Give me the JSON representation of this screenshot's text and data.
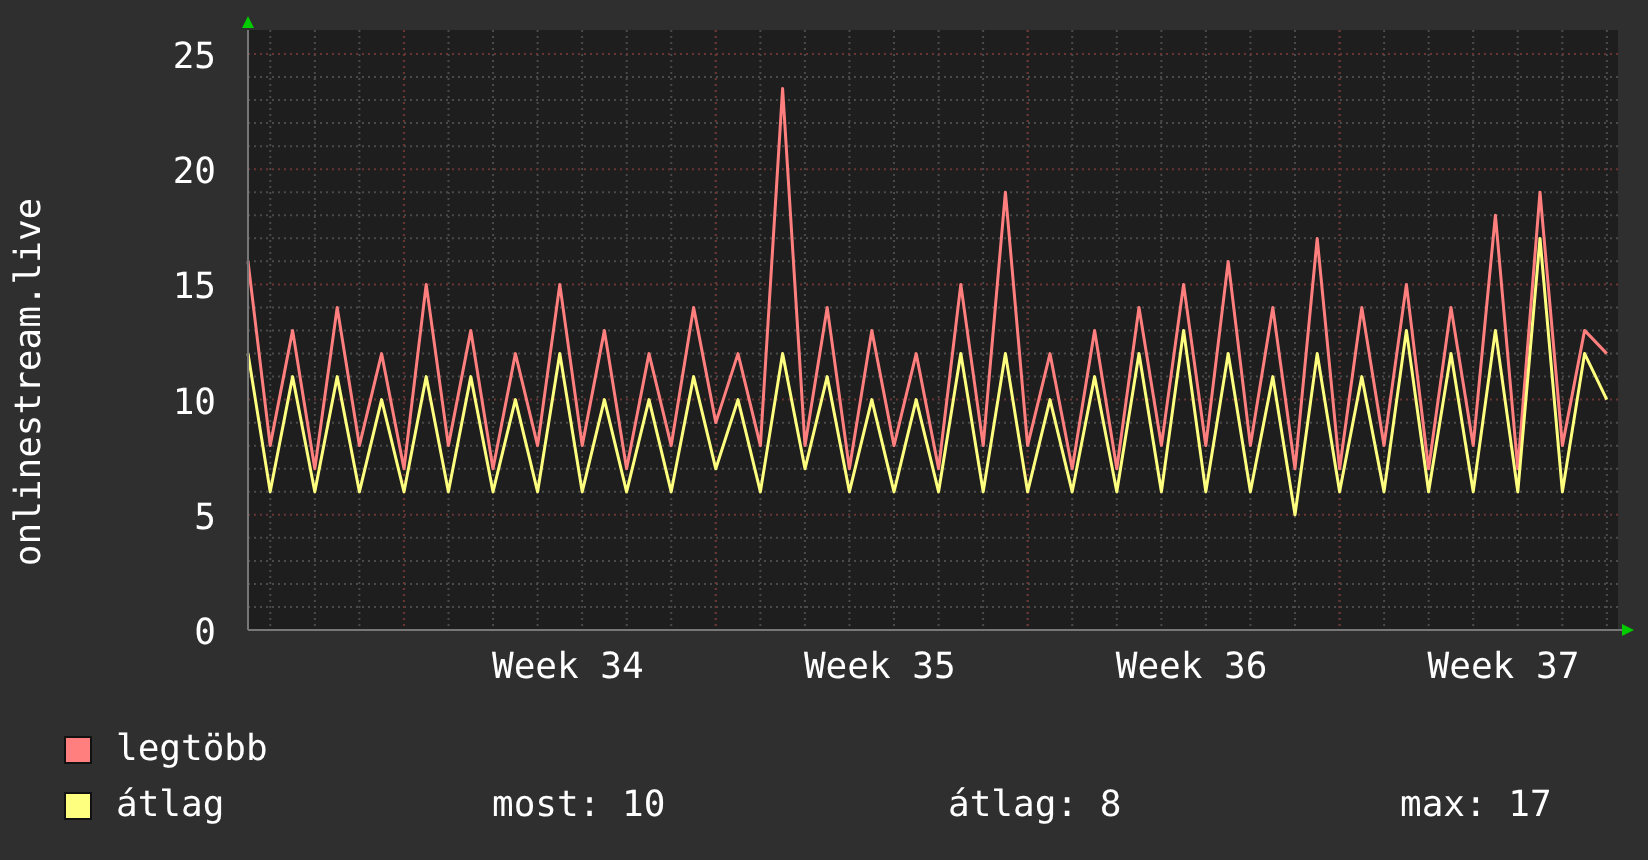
{
  "chart": {
    "chart_data": {
      "type": "line",
      "ylabel": "onlinestream.live",
      "categories": [
        null,
        null,
        null,
        null,
        null,
        null,
        null,
        null,
        null,
        null,
        null,
        null,
        null,
        null,
        "Week 34",
        null,
        null,
        null,
        null,
        null,
        null,
        null,
        null,
        null,
        null,
        null,
        null,
        null,
        "Week 35",
        null,
        null,
        null,
        null,
        null,
        null,
        null,
        null,
        null,
        null,
        null,
        null,
        null,
        "Week 36",
        null,
        null,
        null,
        null,
        null,
        null,
        null,
        null,
        null,
        null,
        null,
        null,
        null,
        "Week 37",
        null,
        null,
        null,
        null,
        null
      ],
      "series": [
        {
          "name": "legtöbb",
          "color": "#ff7f7f",
          "values": [
            16,
            8,
            13,
            7,
            14,
            8,
            12,
            7,
            15,
            8,
            13,
            7,
            12,
            8,
            15,
            8,
            13,
            7,
            12,
            8,
            14,
            9,
            12,
            8,
            23.5,
            8,
            14,
            7,
            13,
            8,
            12,
            7,
            15,
            8,
            19,
            8,
            12,
            7,
            13,
            7,
            14,
            8,
            15,
            8,
            16,
            8,
            14,
            7,
            17,
            7,
            14,
            8,
            15,
            7,
            14,
            8,
            18,
            7,
            19,
            8,
            13,
            12
          ]
        },
        {
          "name": "átlag",
          "color": "#ffff7f",
          "values": [
            12,
            6,
            11,
            6,
            11,
            6,
            10,
            6,
            11,
            6,
            11,
            6,
            10,
            6,
            12,
            6,
            10,
            6,
            10,
            6,
            11,
            7,
            10,
            6,
            12,
            7,
            11,
            6,
            10,
            6,
            10,
            6,
            12,
            6,
            12,
            6,
            10,
            6,
            11,
            6,
            12,
            6,
            13,
            6,
            12,
            6,
            11,
            5,
            12,
            6,
            11,
            6,
            13,
            6,
            12,
            6,
            13,
            6,
            17,
            6,
            12,
            10
          ]
        }
      ],
      "ylim": [
        0,
        25
      ],
      "grid": true,
      "yticks": [
        0,
        5,
        10,
        15,
        20,
        25
      ]
    }
  },
  "stats": [
    "most: 10",
    "átlag: 8",
    "max: 17"
  ]
}
